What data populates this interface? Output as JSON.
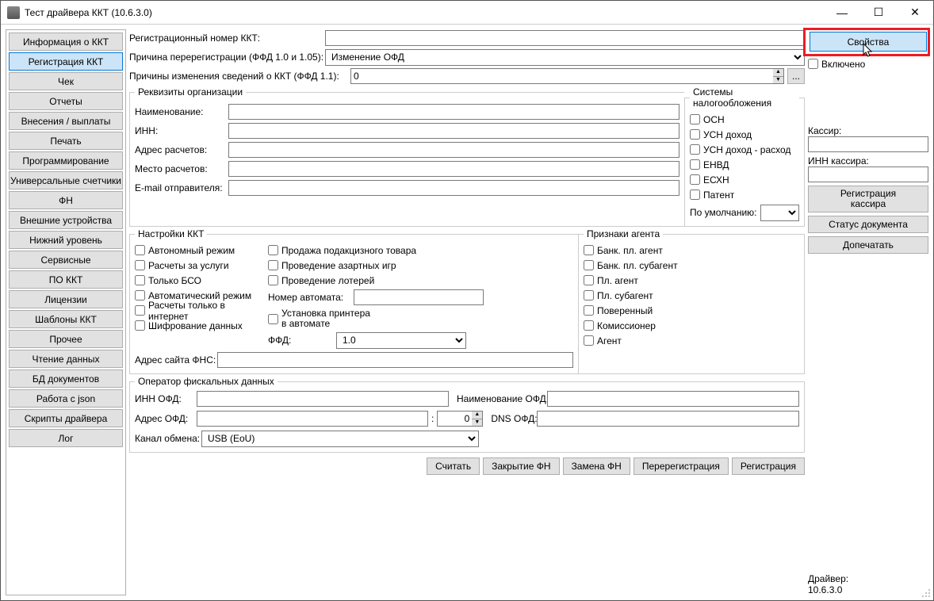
{
  "window": {
    "title": "Тест драйвера ККТ (10.6.3.0)"
  },
  "sidebar": {
    "items": [
      "Информация о ККТ",
      "Регистрация ККТ",
      "Чек",
      "Отчеты",
      "Внесения / выплаты",
      "Печать",
      "Программирование",
      "Универсальные счетчики",
      "ФН",
      "Внешние устройства",
      "Нижний уровень",
      "Сервисные",
      "ПО ККТ",
      "Лицензии",
      "Шаблоны ККТ",
      "Прочее",
      "Чтение данных",
      "БД документов",
      "Работа с json",
      "Скрипты драйвера",
      "Лог"
    ],
    "active_index": 1
  },
  "top": {
    "reg_num_label": "Регистрационный номер ККТ:",
    "rereg_reason_label": "Причина перерегистрации (ФФД 1.0 и 1.05):",
    "rereg_reason_value": "Изменение ОФД",
    "change_info_label": "Причины изменения сведений о ККТ (ФФД 1.1):",
    "change_info_value": "0",
    "ellipsis": "..."
  },
  "org": {
    "legend": "Реквизиты организации",
    "name_label": "Наименование:",
    "inn_label": "ИНН:",
    "payaddr_label": "Адрес расчетов:",
    "payplace_label": "Место расчетов:",
    "email_label": "E-mail отправителя:"
  },
  "tax": {
    "legend": "Системы налогообложения",
    "items": [
      "ОСН",
      "УСН доход",
      "УСН доход - расход",
      "ЕНВД",
      "ЕСХН",
      "Патент"
    ],
    "default_label": "По умолчанию:"
  },
  "kkt": {
    "legend": "Настройки ККТ",
    "col1": [
      "Автономный режим",
      "Расчеты за услуги",
      "Только БСО",
      "Автоматический режим",
      "Расчеты только в интернет",
      "Шифрование данных"
    ],
    "col2": [
      "Продажа подакцизного товара",
      "Проведение азартных игр",
      "Проведение лотерей"
    ],
    "auto_num_label": "Номер автомата:",
    "printer_chk": "Установка принтера в автомате",
    "ffd_label": "ФФД:",
    "ffd_value": "1.0",
    "fns_label": "Адрес сайта ФНС:"
  },
  "agent": {
    "legend": "Признаки агента",
    "items": [
      "Банк. пл. агент",
      "Банк. пл. субагент",
      "Пл. агент",
      "Пл. субагент",
      "Поверенный",
      "Комиссионер",
      "Агент"
    ]
  },
  "ofd": {
    "legend": "Оператор фискальных данных",
    "inn_label": "ИНН ОФД:",
    "name_label": "Наименование ОФД:",
    "addr_label": "Адрес ОФД:",
    "port_sep": ":",
    "port_value": "0",
    "dns_label": "DNS ОФД:",
    "channel_label": "Канал обмена:",
    "channel_value": "USB (EoU)"
  },
  "bottom_buttons": [
    "Считать",
    "Закрытие ФН",
    "Замена ФН",
    "Перерегистрация",
    "Регистрация"
  ],
  "right": {
    "props_btn": "Свойства",
    "enabled_chk": "Включено",
    "cashier_label": "Кассир:",
    "cashier_inn_label": "ИНН кассира:",
    "reg_cashier_btn": "Регистрация\nкассира",
    "status_btn": "Статус документа",
    "reprint_btn": "Допечатать",
    "driver_label": "Драйвер:",
    "driver_ver": "10.6.3.0"
  }
}
